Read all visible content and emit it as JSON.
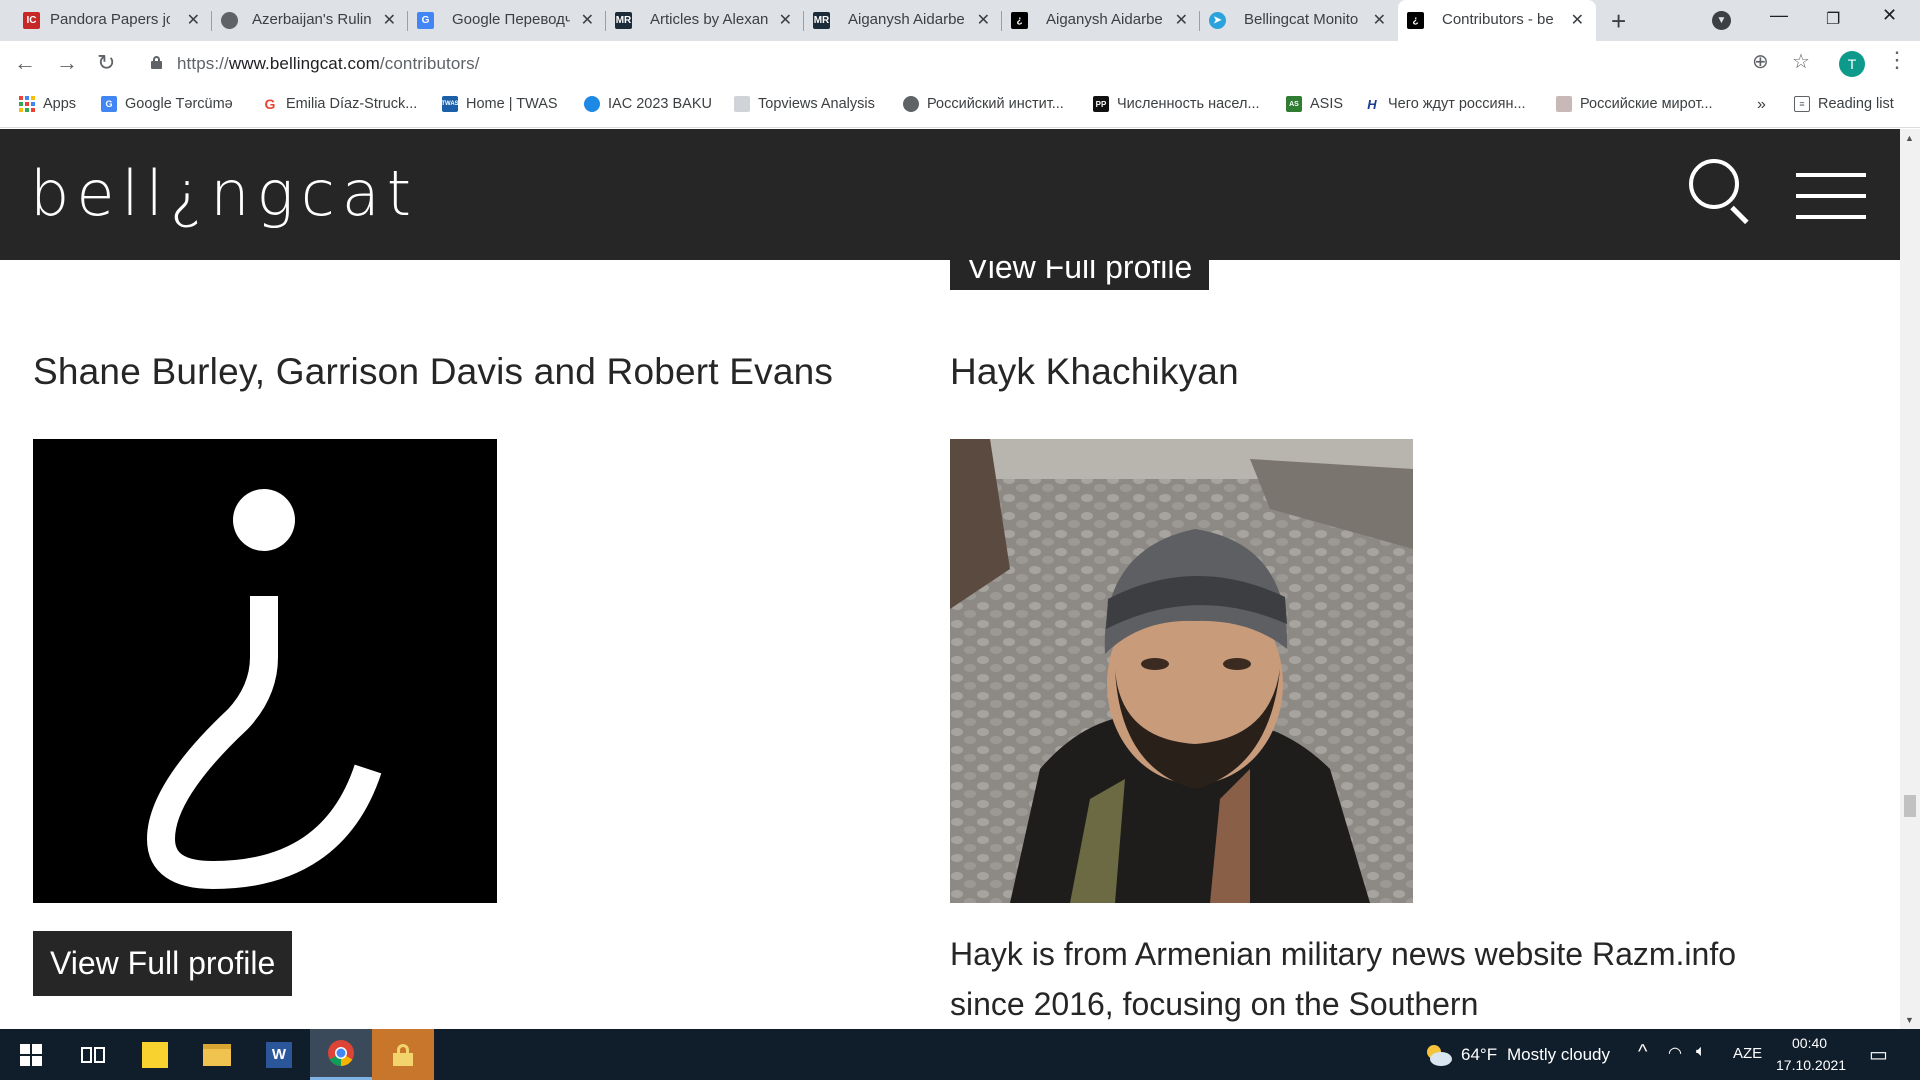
{
  "browser": {
    "tabs": [
      {
        "label": "Pandora Papers jo",
        "favicon": "icij-icon",
        "color": "#c62828"
      },
      {
        "label": "Azerbaijan's Rulin",
        "favicon": "globe-icon",
        "color": "#5f6368"
      },
      {
        "label": "Google Переводч",
        "favicon": "google-translate-icon",
        "color": "#4285f4"
      },
      {
        "label": "Articles by Alexan",
        "favicon": "mr-icon",
        "color": "#1c2b3a"
      },
      {
        "label": "Aiganysh Aidarbe",
        "favicon": "mr-icon",
        "color": "#1c2b3a"
      },
      {
        "label": "Aiganysh Aidarbe",
        "favicon": "bellingcat-icon",
        "color": "#000000"
      },
      {
        "label": "Bellingcat Monito",
        "favicon": "telegram-icon",
        "color": "#2aa3dd"
      },
      {
        "label": "Contributors - be",
        "favicon": "bellingcat-icon",
        "color": "#000000",
        "active": true
      }
    ],
    "url_prefix": "https://",
    "url_host": "www.bellingcat.com",
    "url_path": "/contributors/",
    "profile_initial": "T",
    "bookmarks": [
      {
        "label": "Apps",
        "icon": "apps-icon"
      },
      {
        "label": "Google Tərcümə",
        "icon": "google-translate-icon"
      },
      {
        "label": "Emilia Díaz-Struck...",
        "icon": "google-icon"
      },
      {
        "label": "Home | TWAS",
        "icon": "twas-icon"
      },
      {
        "label": "IAC 2023 BAKU",
        "icon": "iac-icon"
      },
      {
        "label": "Topviews Analysis",
        "icon": "image-icon"
      },
      {
        "label": "Российский инстит...",
        "icon": "globe-icon"
      },
      {
        "label": "Численность насел...",
        "icon": "pp-icon"
      },
      {
        "label": "ASIS",
        "icon": "asis-icon"
      },
      {
        "label": "Чего ждут россиян...",
        "icon": "h-icon"
      },
      {
        "label": "Российские мирот...",
        "icon": "image-icon"
      }
    ],
    "bookmarks_overflow": "»",
    "reading_list": "Reading list"
  },
  "site": {
    "logo": "bell¿ngcat",
    "profiles": [
      {
        "name": "Shane Burley, Garrison Davis and Robert Evans",
        "button": "View Full profile"
      },
      {
        "name": "Hayk Khachikyan",
        "button": "View Full profile",
        "bio": "Hayk is from Armenian military news website Razm.info since 2016, focusing on the Southern"
      }
    ],
    "cut_button": "View Full profile"
  },
  "taskbar": {
    "weather_temp": "64°F",
    "weather_text": "Mostly cloudy",
    "language": "AZE",
    "time": "00:40",
    "date": "17.10.2021"
  }
}
